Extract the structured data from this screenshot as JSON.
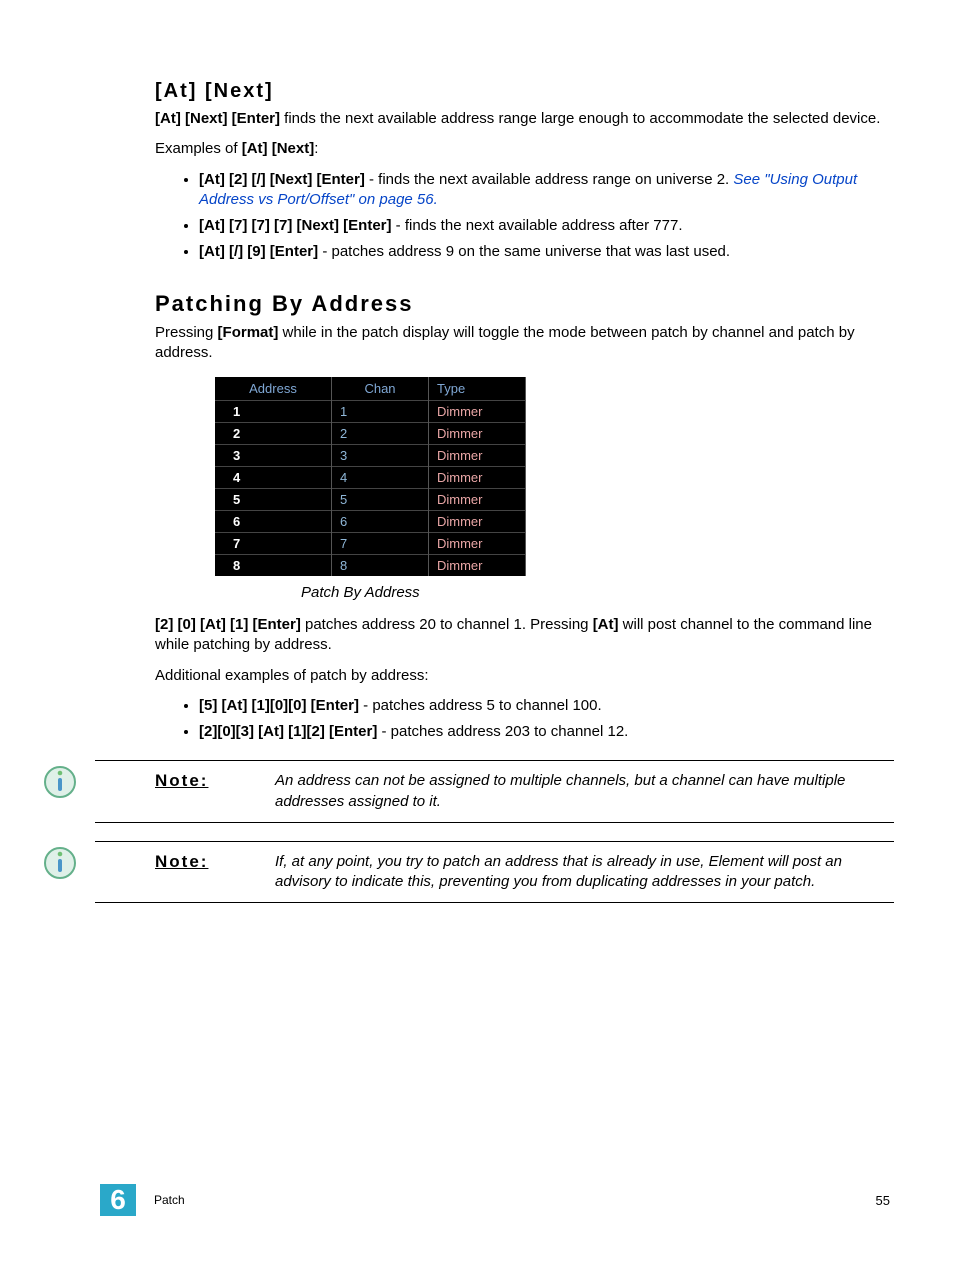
{
  "section1": {
    "title": "[At] [Next]",
    "intro_keys": "[At] [Next] [Enter]",
    "intro_rest": " finds the next available address range large enough to accommodate the selected device.",
    "examples_lead": "Examples of ",
    "examples_keys": "[At] [Next]",
    "examples_tail": ":",
    "bullets": [
      {
        "keys": "[At] [2] [/] [Next] [Enter]",
        "rest": " - finds the next available address range on universe 2. ",
        "link": "See \"Using Output Address vs Port/Offset\" on page 56."
      },
      {
        "keys": "[At] [7] [7] [7] [Next] [Enter]",
        "rest": " - finds the next available address after 777."
      },
      {
        "keys": "[At] [/] [9] [Enter]",
        "rest": " - patches address 9 on the same universe that was last used."
      }
    ]
  },
  "section2": {
    "title": "Patching By Address",
    "p1_a": "Pressing ",
    "p1_b": "[Format]",
    "p1_c": " while in the patch display will toggle the mode between patch by channel and patch by address.",
    "table": {
      "headers": [
        "Address",
        "Chan",
        "Type"
      ],
      "rows": [
        {
          "addr": "1",
          "chan": "1",
          "type": "Dimmer"
        },
        {
          "addr": "2",
          "chan": "2",
          "type": "Dimmer"
        },
        {
          "addr": "3",
          "chan": "3",
          "type": "Dimmer"
        },
        {
          "addr": "4",
          "chan": "4",
          "type": "Dimmer"
        },
        {
          "addr": "5",
          "chan": "5",
          "type": "Dimmer"
        },
        {
          "addr": "6",
          "chan": "6",
          "type": "Dimmer"
        },
        {
          "addr": "7",
          "chan": "7",
          "type": "Dimmer"
        },
        {
          "addr": "8",
          "chan": "8",
          "type": "Dimmer"
        }
      ]
    },
    "caption": "Patch By Address",
    "p2_a": "[2] [0] [At] [1] [Enter]",
    "p2_b": " patches address 20 to channel 1. Pressing ",
    "p2_c": "[At]",
    "p2_d": " will post channel to the command line while patching by address.",
    "p3": "Additional examples of patch by address:",
    "bullets": [
      {
        "keys": "[5] [At] [1][0][0] [Enter]",
        "rest": " - patches address 5 to channel 100."
      },
      {
        "keys": "[2][0][3] [At] [1][2] [Enter]",
        "rest": " - patches address 203 to channel 12."
      }
    ]
  },
  "notes": [
    {
      "label": "Note:",
      "text": "An address can not be assigned to multiple channels, but a channel can have multiple addresses assigned to it."
    },
    {
      "label": "Note:",
      "text": "If, at any point, you try to patch an address that is already in use, Element will post an advisory to indicate this, preventing you from duplicating addresses in your patch."
    }
  ],
  "footer": {
    "chapter_num": "6",
    "chapter_name": "Patch",
    "page": "55"
  }
}
